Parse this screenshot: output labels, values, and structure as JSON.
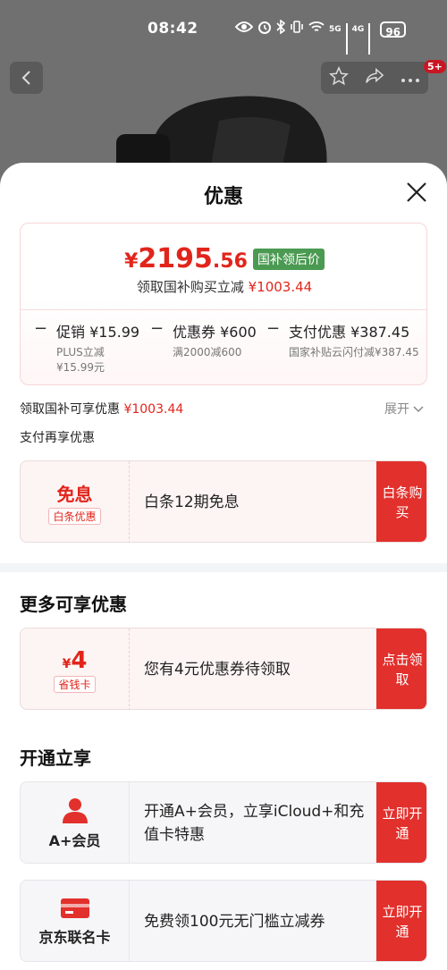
{
  "status": {
    "time": "08:42",
    "net1": "5G",
    "net2": "4G",
    "battery": "96"
  },
  "header": {
    "cart_badge": "5+"
  },
  "sheet": {
    "title": "优惠",
    "price": {
      "yen": "¥",
      "integer": "2195",
      "decimal": ".56",
      "tag": "国补领后价",
      "sub_label": "领取国补购买立减",
      "sub_value": "¥1003.44"
    },
    "breakdown": [
      {
        "main": "促销 ¥15.99",
        "sub1": "PLUS立减",
        "sub2": "¥15.99元"
      },
      {
        "main": "优惠券 ¥600",
        "sub1": "满2000减600",
        "sub2": ""
      },
      {
        "main": "支付优惠 ¥387.45",
        "sub1": "国家补贴云闪付减¥387.45",
        "sub2": ""
      }
    ],
    "dash": "−",
    "gov_label": "领取国补可享优惠",
    "gov_value": "¥1003.44",
    "expand": "展开",
    "pay_more": "支付再享优惠",
    "baitiao": {
      "big": "免息",
      "tag": "白条优惠",
      "desc": "白条12期免息",
      "button": "白条购买"
    },
    "more_title": "更多可享优惠",
    "coupon": {
      "yen": "¥",
      "amount": "4",
      "tag": "省钱卡",
      "desc": "您有4元优惠券待领取",
      "button": "点击领取"
    },
    "open_title": "开通立享",
    "member": {
      "label": "A+会员",
      "desc": "开通A+会员，立享iCloud+和充值卡特惠",
      "button": "立即开通"
    },
    "card": {
      "label": "京东联名卡",
      "desc": "免费领100元无门槛立减券",
      "button": "立即开通"
    }
  },
  "colors": {
    "accent_red": "#e2302c",
    "price_red": "#e1251b",
    "tag_green": "#4b9a52"
  }
}
